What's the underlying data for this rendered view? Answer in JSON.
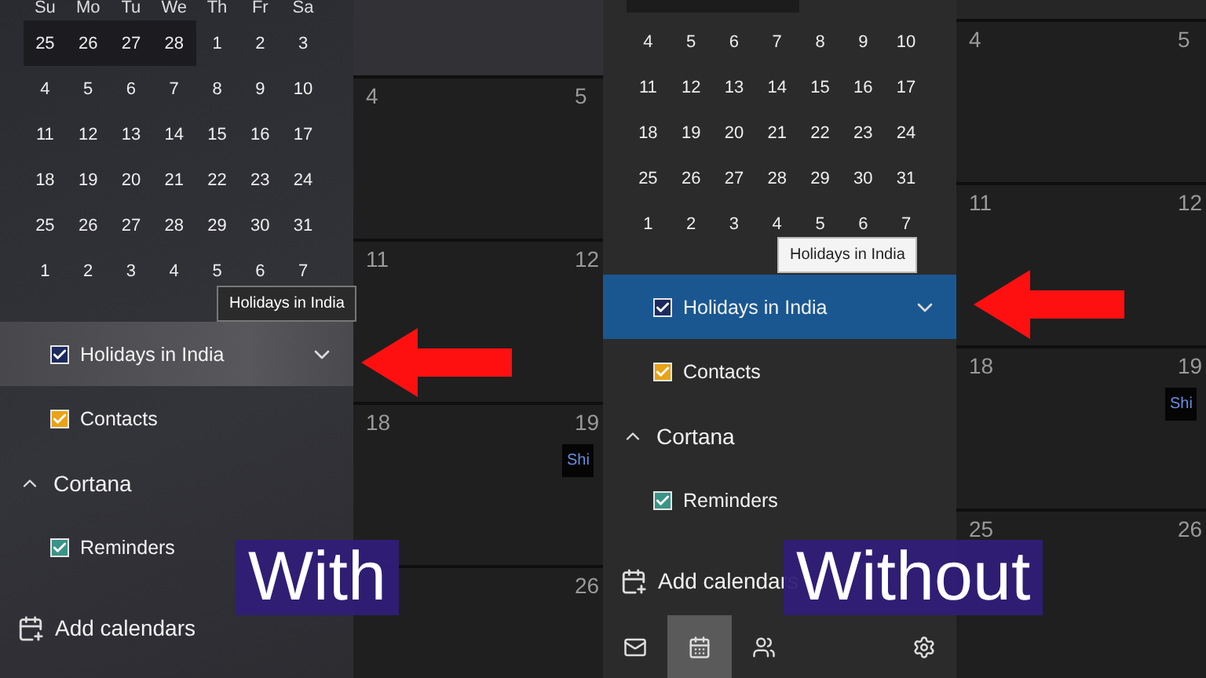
{
  "panels": [
    {
      "label": "With",
      "acrylic": true,
      "weekdays": [
        "Su",
        "Mo",
        "Tu",
        "We",
        "Th",
        "Fr",
        "Sa"
      ],
      "top_row_cut": false,
      "weeks": [
        [
          {
            "d": "25",
            "shaded": true
          },
          {
            "d": "26",
            "shaded": true
          },
          {
            "d": "27",
            "shaded": true
          },
          {
            "d": "28",
            "shaded": true
          },
          {
            "d": "1",
            "shaded": false
          },
          {
            "d": "2",
            "shaded": false
          },
          {
            "d": "3",
            "shaded": false
          }
        ],
        [
          {
            "d": "4",
            "shaded": false
          },
          {
            "d": "5",
            "shaded": false
          },
          {
            "d": "6",
            "shaded": false
          },
          {
            "d": "7",
            "shaded": false
          },
          {
            "d": "8",
            "shaded": false
          },
          {
            "d": "9",
            "shaded": false
          },
          {
            "d": "10",
            "shaded": false
          }
        ],
        [
          {
            "d": "11",
            "shaded": false
          },
          {
            "d": "12",
            "shaded": false
          },
          {
            "d": "13",
            "shaded": false
          },
          {
            "d": "14",
            "shaded": false
          },
          {
            "d": "15",
            "shaded": false
          },
          {
            "d": "16",
            "shaded": false
          },
          {
            "d": "17",
            "shaded": false
          }
        ],
        [
          {
            "d": "18",
            "shaded": false
          },
          {
            "d": "19",
            "shaded": false
          },
          {
            "d": "20",
            "shaded": false
          },
          {
            "d": "21",
            "shaded": false
          },
          {
            "d": "22",
            "shaded": false
          },
          {
            "d": "23",
            "shaded": false
          },
          {
            "d": "24",
            "shaded": false
          }
        ],
        [
          {
            "d": "25",
            "shaded": false
          },
          {
            "d": "26",
            "shaded": false
          },
          {
            "d": "27",
            "shaded": false
          },
          {
            "d": "28",
            "shaded": false
          },
          {
            "d": "29",
            "shaded": false
          },
          {
            "d": "30",
            "shaded": false
          },
          {
            "d": "31",
            "shaded": false
          }
        ],
        [
          {
            "d": "1",
            "shaded": false
          },
          {
            "d": "2",
            "shaded": false
          },
          {
            "d": "3",
            "shaded": false
          },
          {
            "d": "4",
            "shaded": false
          },
          {
            "d": "5",
            "shaded": false
          },
          {
            "d": "6",
            "shaded": false
          },
          {
            "d": "7",
            "shaded": false
          }
        ]
      ],
      "tooltip": "Holidays in India",
      "items": [
        {
          "kind": "calendar",
          "label": "Holidays in India",
          "checked": true,
          "color": "#1c2a5e",
          "selected": true
        },
        {
          "kind": "calendar",
          "label": "Contacts",
          "checked": true,
          "color": "#e8a317",
          "selected": false
        },
        {
          "kind": "group",
          "label": "Cortana",
          "expanded": true,
          "selected": false
        },
        {
          "kind": "calendar",
          "label": "Reminders",
          "checked": true,
          "color": "#3a9487",
          "selected": false
        }
      ],
      "add_calendars": "Add calendars",
      "month_rows": [
        {
          "cells": [
            {
              "date": "4"
            },
            {
              "date": "5"
            }
          ]
        },
        {
          "cells": [
            {
              "date": "11"
            },
            {
              "date": "12"
            }
          ]
        },
        {
          "cells": [
            {
              "date": "18"
            },
            {
              "date": "19",
              "event": "Shi"
            }
          ]
        },
        {
          "cells": [
            {},
            {
              "date": "26"
            }
          ]
        }
      ]
    },
    {
      "label": "Without",
      "acrylic": false,
      "top_row_cut": true,
      "weeks": [
        [
          {
            "d": "4",
            "shaded": false
          },
          {
            "d": "5",
            "shaded": false
          },
          {
            "d": "6",
            "shaded": false
          },
          {
            "d": "7",
            "shaded": false
          },
          {
            "d": "8",
            "shaded": false
          },
          {
            "d": "9",
            "shaded": false
          },
          {
            "d": "10",
            "shaded": false
          }
        ],
        [
          {
            "d": "11",
            "shaded": false
          },
          {
            "d": "12",
            "shaded": false
          },
          {
            "d": "13",
            "shaded": false
          },
          {
            "d": "14",
            "shaded": false
          },
          {
            "d": "15",
            "shaded": false
          },
          {
            "d": "16",
            "shaded": false
          },
          {
            "d": "17",
            "shaded": false
          }
        ],
        [
          {
            "d": "18",
            "shaded": false
          },
          {
            "d": "19",
            "shaded": false
          },
          {
            "d": "20",
            "shaded": false
          },
          {
            "d": "21",
            "shaded": false
          },
          {
            "d": "22",
            "shaded": false
          },
          {
            "d": "23",
            "shaded": false
          },
          {
            "d": "24",
            "shaded": false
          }
        ],
        [
          {
            "d": "25",
            "shaded": false
          },
          {
            "d": "26",
            "shaded": false
          },
          {
            "d": "27",
            "shaded": false
          },
          {
            "d": "28",
            "shaded": false
          },
          {
            "d": "29",
            "shaded": false
          },
          {
            "d": "30",
            "shaded": false
          },
          {
            "d": "31",
            "shaded": false
          }
        ],
        [
          {
            "d": "1",
            "shaded": false
          },
          {
            "d": "2",
            "shaded": false
          },
          {
            "d": "3",
            "shaded": false
          },
          {
            "d": "4",
            "shaded": false
          },
          {
            "d": "5",
            "shaded": false
          },
          {
            "d": "6",
            "shaded": false
          },
          {
            "d": "7",
            "shaded": false
          }
        ]
      ],
      "tooltip": "Holidays in India",
      "items": [
        {
          "kind": "calendar",
          "label": "Holidays in India",
          "checked": true,
          "color": "#1c2a5e",
          "selected": true
        },
        {
          "kind": "calendar",
          "label": "Contacts",
          "checked": true,
          "color": "#e8a317",
          "selected": false
        },
        {
          "kind": "group",
          "label": "Cortana",
          "expanded": true,
          "selected": false
        },
        {
          "kind": "calendar",
          "label": "Reminders",
          "checked": true,
          "color": "#3a9487",
          "selected": false
        }
      ],
      "add_calendars": "Add calendars",
      "nav": [
        {
          "kind": "mail",
          "selected": false
        },
        {
          "kind": "calendar",
          "selected": true
        },
        {
          "kind": "people",
          "selected": false
        },
        {
          "kind": "settings",
          "selected": false
        }
      ],
      "month_rows": [
        {
          "cells": [
            {
              "date": "4"
            },
            {
              "date": "5"
            }
          ]
        },
        {
          "cells": [
            {
              "date": "11"
            },
            {
              "date": "12"
            }
          ]
        },
        {
          "cells": [
            {
              "date": "18"
            },
            {
              "date": "19",
              "event": "Shi"
            }
          ]
        },
        {
          "cells": [
            {
              "date": "25"
            },
            {
              "date": "26"
            }
          ]
        }
      ]
    }
  ]
}
